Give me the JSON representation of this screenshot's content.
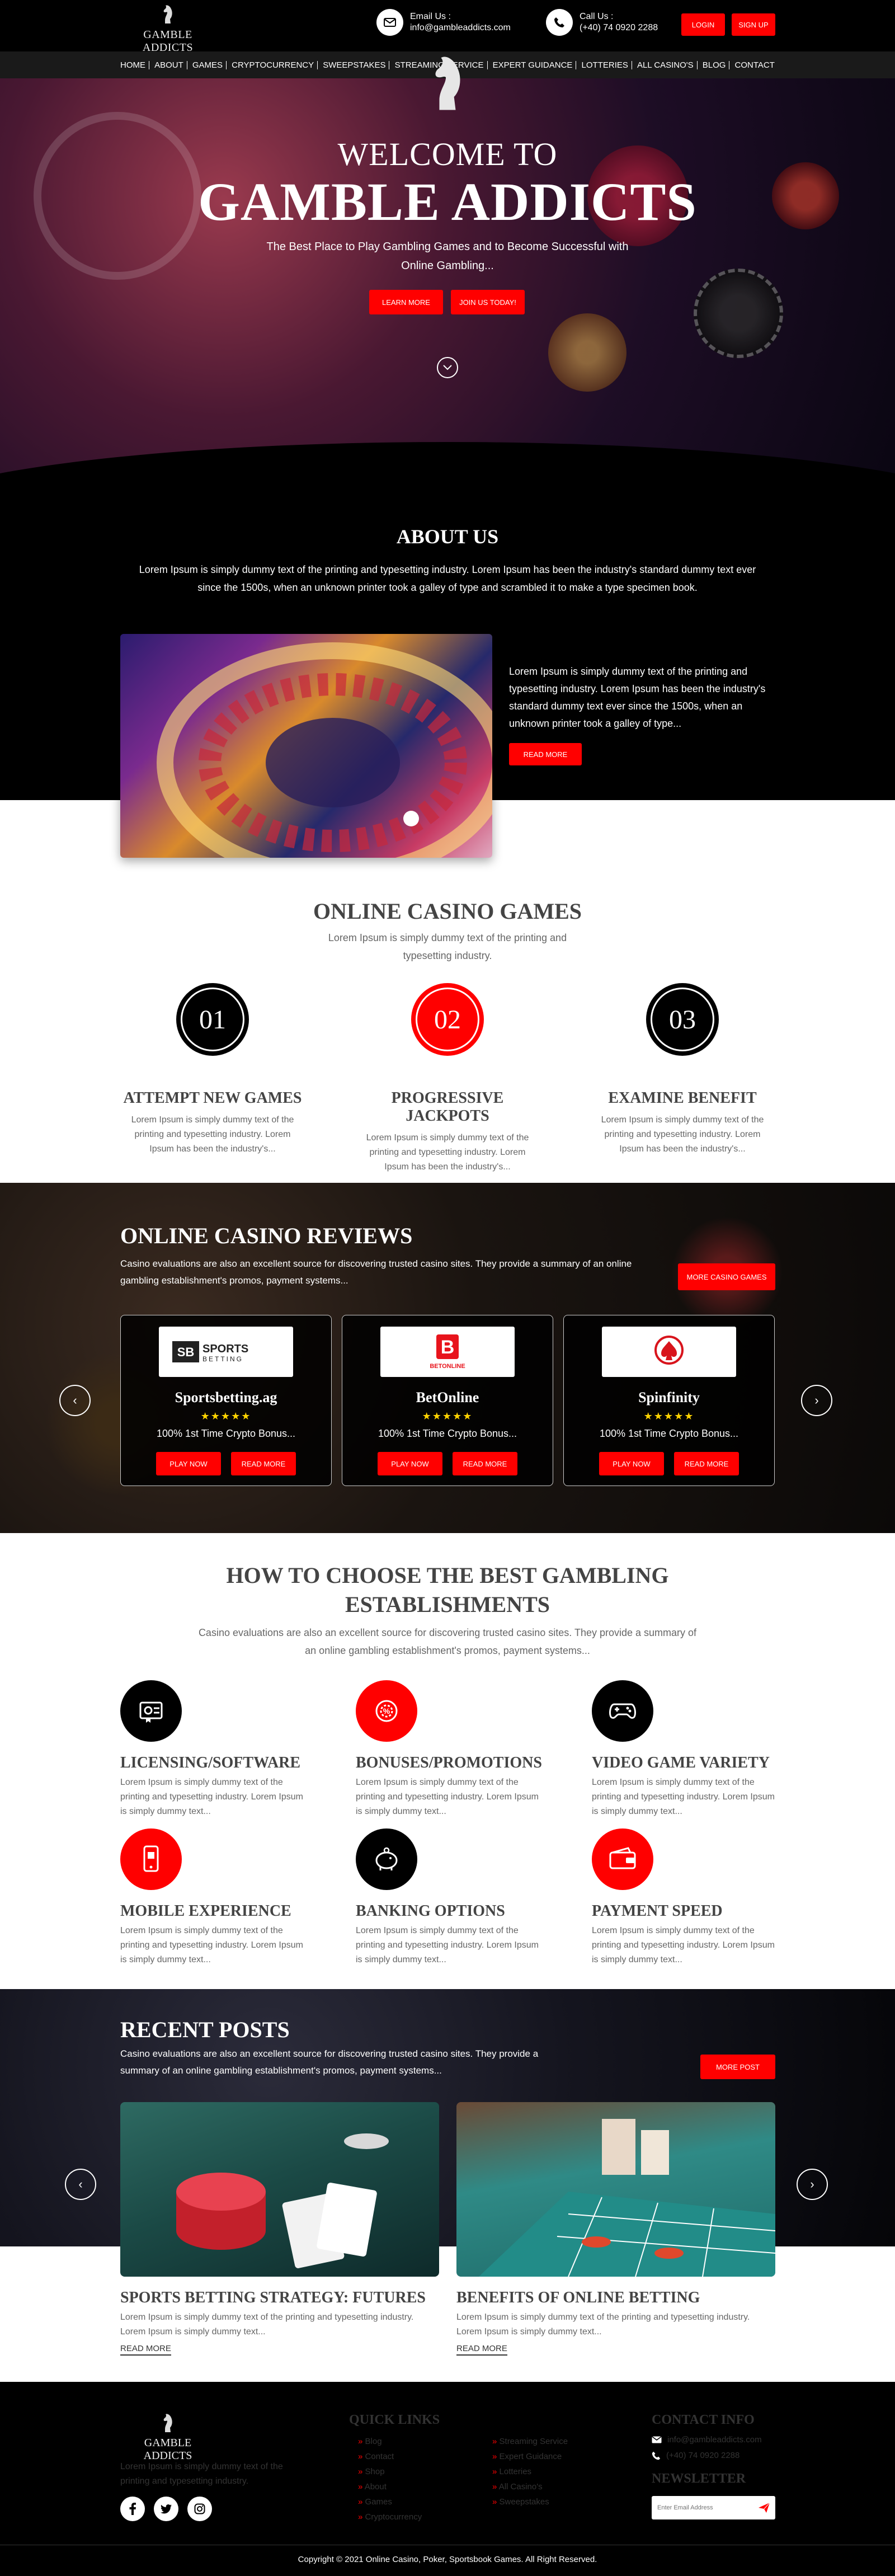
{
  "header": {
    "logo_text": "GAMBLE ADDICTS",
    "email_label": "Email Us :",
    "email_value": "info@gambleaddicts.com",
    "call_label": "Call Us :",
    "call_value": "(+40) 74 0920 2288",
    "login": "LOGIN",
    "signup": "SIGN UP"
  },
  "nav": [
    "HOME",
    "ABOUT",
    "GAMES",
    "CRYPTOCURRENCY",
    "SWEEPSTAKES",
    "STREAMING SERVICE",
    "EXPERT GUIDANCE",
    "LOTTERIES",
    "ALL CASINO'S",
    "BLOG",
    "CONTACT"
  ],
  "hero": {
    "pre": "WELCOME TO",
    "title": "GAMBLE ADDICTS",
    "subtitle": "The Best Place to Play Gambling Games and to Become Successful with Online Gambling...",
    "learn_more": "LEARN MORE",
    "join": "JOIN US TODAY!"
  },
  "about": {
    "title": "ABOUT US",
    "text": "Lorem Ipsum is simply dummy text of the printing and typesetting industry. Lorem Ipsum has been the industry's standard dummy text ever since the 1500s, when an unknown printer took a galley of type and scrambled it to make a type specimen book.",
    "para": "Lorem Ipsum is simply dummy text of the printing and typesetting industry. Lorem Ipsum has been the industry's standard dummy text ever since the 1500s, when an unknown printer took a galley of type...",
    "read_more": "READ MORE"
  },
  "games": {
    "title": "ONLINE CASINO GAMES",
    "subtitle": "Lorem Ipsum is simply dummy text of the printing and typesetting industry.",
    "items": [
      {
        "num": "01",
        "title": "ATTEMPT NEW GAMES",
        "text": "Lorem Ipsum is simply dummy text of the printing and typesetting industry. Lorem Ipsum has been the industry's...",
        "color": "#000000"
      },
      {
        "num": "02",
        "title": "PROGRESSIVE JACKPOTS",
        "text": "Lorem Ipsum is simply dummy text of the printing and typesetting industry. Lorem Ipsum has been the industry's...",
        "color": "#ff0000"
      },
      {
        "num": "03",
        "title": "EXAMINE BENEFIT",
        "text": "Lorem Ipsum is simply dummy text of the printing and typesetting industry. Lorem Ipsum has been the industry's...",
        "color": "#000000"
      }
    ]
  },
  "reviews": {
    "title": "ONLINE CASINO REVIEWS",
    "subtitle": "Casino evaluations are also an excellent source for discovering trusted casino sites. They provide a summary of an online gambling establishment's promos, payment systems...",
    "more": "MORE CASINO GAMES",
    "cards": [
      {
        "name": "Sportsbetting.ag",
        "logo": "SPORTS BETTING",
        "stars": "★★★★★",
        "bonus": "100% 1st Time Crypto Bonus...",
        "play": "PLAY NOW",
        "read": "READ MORE"
      },
      {
        "name": "BetOnline",
        "logo": "BETONLINE",
        "stars": "★★★★★",
        "bonus": "100% 1st Time Crypto Bonus...",
        "play": "PLAY NOW",
        "read": "READ MORE"
      },
      {
        "name": "Spinfinity",
        "logo": "SPINFINITY",
        "stars": "★★★★★",
        "bonus": "100% 1st Time Crypto Bonus...",
        "play": "PLAY NOW",
        "read": "READ MORE"
      }
    ]
  },
  "choose": {
    "title": "HOW TO CHOOSE THE BEST GAMBLING ESTABLISHMENTS",
    "subtitle": "Casino evaluations are also an excellent source for discovering trusted casino sites. They provide a summary of an online gambling establishment's promos, payment systems...",
    "items": [
      {
        "title": "LICENSING/SOFTWARE",
        "text": "Lorem Ipsum is simply dummy text of the printing and typesetting industry. Lorem Ipsum is simply dummy text...",
        "icon": "license-icon",
        "color": "#000000"
      },
      {
        "title": "BONUSES/PROMOTIONS",
        "text": "Lorem Ipsum is simply dummy text of the printing and typesetting industry. Lorem Ipsum is simply dummy text...",
        "icon": "bonus-icon",
        "color": "#ff0000"
      },
      {
        "title": "VIDEO GAME VARIETY",
        "text": "Lorem Ipsum is simply dummy text of the printing and typesetting industry. Lorem Ipsum is simply dummy text...",
        "icon": "gamepad-icon",
        "color": "#000000"
      },
      {
        "title": "MOBILE EXPERIENCE",
        "text": "Lorem Ipsum is simply dummy text of the printing and typesetting industry. Lorem Ipsum is simply dummy text...",
        "icon": "mobile-icon",
        "color": "#ff0000"
      },
      {
        "title": "BANKING OPTIONS",
        "text": "Lorem Ipsum is simply dummy text of the printing and typesetting industry. Lorem Ipsum is simply dummy text...",
        "icon": "piggy-bank-icon",
        "color": "#000000"
      },
      {
        "title": "PAYMENT SPEED",
        "text": "Lorem Ipsum is simply dummy text of the printing and typesetting industry. Lorem Ipsum is simply dummy text...",
        "icon": "wallet-icon",
        "color": "#ff0000"
      }
    ]
  },
  "posts": {
    "title": "RECENT POSTS",
    "subtitle": "Casino evaluations are also an excellent source for discovering trusted casino sites. They provide a summary of an online gambling establishment's promos, payment systems...",
    "more": "MORE POST",
    "items": [
      {
        "title": "SPORTS BETTING STRATEGY: FUTURES",
        "text": "Lorem Ipsum is simply dummy text of the printing and typesetting industry. Lorem Ipsum is simply dummy text...",
        "read": "READ MORE"
      },
      {
        "title": "BENEFITS OF ONLINE BETTING",
        "text": "Lorem Ipsum is simply dummy text of the printing and typesetting industry. Lorem Ipsum is simply dummy text...",
        "read": "READ MORE"
      }
    ]
  },
  "footer": {
    "logo_text": "GAMBLE ADDICTS",
    "about": "Lorem Ipsum is simply dummy text of the printing and typesetting industry.",
    "quick_links_title": "QUICK LINKS",
    "links_col1": [
      "Blog",
      "Contact",
      "Shop",
      "About",
      "Games",
      "Cryptocurrency"
    ],
    "links_col2": [
      "Streaming Service",
      "Expert Guidance",
      "Lotteries",
      "All Casino's",
      "Sweepstakes"
    ],
    "contact_title": "CONTACT INFO",
    "email": "info@gambleaddicts.com",
    "phone": "(+40) 74 0920 2288",
    "newsletter_title": "NEWSLETTER",
    "newsletter_placeholder": "Enter Email Address",
    "copyright": "Copyright © 2021 Online Casino, Poker, Sportsbook Games. All Right Reserved."
  },
  "colors": {
    "accent": "#ff0000",
    "dark": "#000000"
  }
}
